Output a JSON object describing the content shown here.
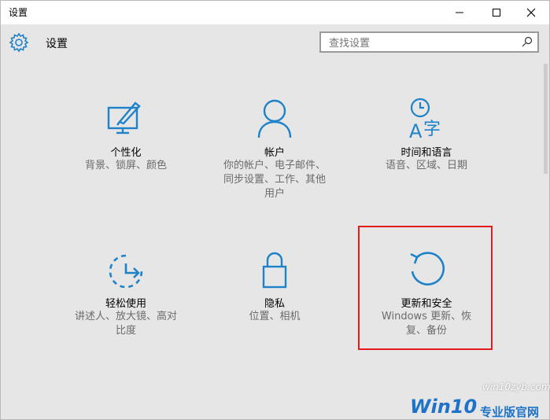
{
  "window": {
    "title": "设置",
    "controls": {
      "minimize": "minimize-icon",
      "maximize": "maximize-icon",
      "close": "close-icon"
    }
  },
  "header": {
    "icon": "gear-icon",
    "title": "设置",
    "search_placeholder": "查找设置",
    "search_icon": "search-icon"
  },
  "tiles": [
    {
      "name": "个性化",
      "desc_lines": [
        "背景、锁屏、颜色"
      ],
      "icon": "personalization-icon"
    },
    {
      "name": "帐户",
      "desc_lines": [
        "你的帐户、电子邮件、",
        "同步设置、工作、其他",
        "用户"
      ],
      "icon": "account-icon"
    },
    {
      "name": "时间和语言",
      "desc_lines": [
        "语音、区域、日期"
      ],
      "icon": "time-language-icon"
    },
    {
      "name": "轻松使用",
      "desc_lines": [
        "讲述人、放大镜、高对",
        "比度"
      ],
      "icon": "ease-of-access-icon"
    },
    {
      "name": "隐私",
      "desc_lines": [
        "位置、相机"
      ],
      "icon": "privacy-lock-icon"
    },
    {
      "name": "更新和安全",
      "desc_lines": [
        "Windows 更新、恢",
        "复、备份"
      ],
      "icon": "update-icon"
    }
  ],
  "watermark": {
    "url": "win10zyb.com",
    "brand": "Win10",
    "brand_cn": "专业版官网"
  },
  "colors": {
    "accent": "#1e82c8",
    "highlight": "#e21c1c"
  }
}
